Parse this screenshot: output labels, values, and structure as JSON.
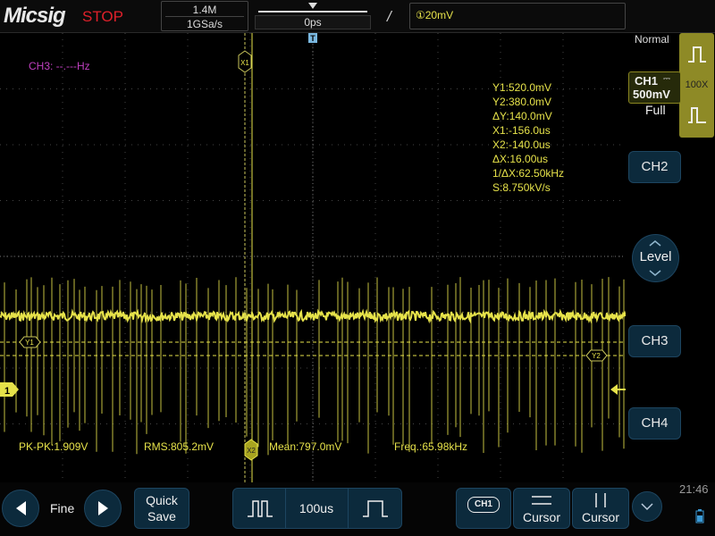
{
  "header": {
    "logo": "Micsig",
    "run_state": "STOP",
    "memory_depth": "1.4M",
    "sample_rate": "1GSa/s",
    "horizontal_position": "0ps",
    "trigger_slope_glyph": "/",
    "trigger_level": "①20mV"
  },
  "channel3_freq": "CH3: --.---Hz",
  "cursor_readout": {
    "y1": "Y1:520.0mV",
    "y2": "Y2:380.0mV",
    "dy": "ΔY:140.0mV",
    "x1": "X1:-156.0us",
    "x2": "X2:-140.0us",
    "dx": "ΔX:16.00us",
    "inv_dx": "1/ΔX:62.50kHz",
    "slope": "S:8.750kV/s"
  },
  "cursor_labels": {
    "x1": "X1",
    "x2": "X2",
    "y1": "Y1",
    "y2": "Y2"
  },
  "measurements": {
    "pkpk": "PK-PK:1.909V",
    "rms": "RMS:805.2mV",
    "mean": "Mean:797.0mV",
    "freq": "Freq.:65.98kHz"
  },
  "channel1_marker": "1",
  "right_panel": {
    "trigger_mode": "Normal",
    "ch1_name": "CH1",
    "ch1_coupling": "⎓",
    "ch1_scale": "500mV",
    "ch1_bandwidth": "Full",
    "probe": "100X",
    "ch2": "CH2",
    "level": "Level",
    "ch3": "CH3",
    "ch4": "CH4"
  },
  "bottom": {
    "fine_label": "Fine",
    "quick_save_line1": "Quick",
    "quick_save_line2": "Save",
    "timebase": "100us",
    "ch_select": "CH1",
    "cursor1": "Cursor",
    "cursor2": "Cursor",
    "clock": "21:46"
  },
  "colors": {
    "ch1": "#e6e24a",
    "ch3": "#c040c0",
    "stop": "#e0202a",
    "button": "#0c2a3c"
  }
}
